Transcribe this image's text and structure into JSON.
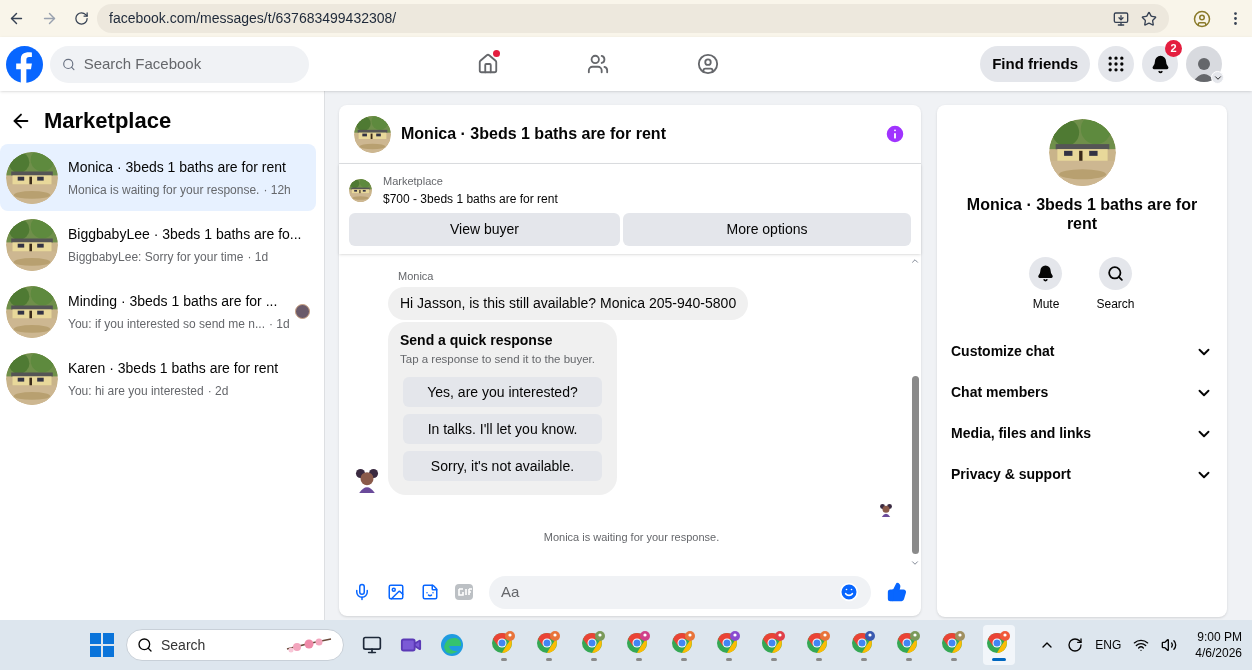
{
  "browser": {
    "url": "facebook.com/messages/t/637683499432308/"
  },
  "header": {
    "search_placeholder": "Search Facebook",
    "nav": [
      {
        "kind": "home",
        "dot": true
      },
      {
        "kind": "friends",
        "dot": false
      },
      {
        "kind": "groups",
        "dot": false
      }
    ],
    "find_friends": "Find friends",
    "notification_count": "2"
  },
  "sidebar": {
    "title": "Marketplace",
    "conversations": [
      {
        "title": "Monica · 3beds 1 baths are for rent",
        "preview": "Monica is waiting for your response.",
        "time": "· 12h",
        "selected": true,
        "seen": false
      },
      {
        "title": "BiggbabyLee · 3beds 1 baths are fo...",
        "preview": "BiggbabyLee: Sorry for your time",
        "time": "· 1d",
        "selected": false,
        "seen": false
      },
      {
        "title": "Minding · 3beds 1 baths are for ...",
        "preview": "You: if you interested so send me n...",
        "time": "· 1d",
        "selected": false,
        "seen": true
      },
      {
        "title": "Karen · 3beds 1 baths are for rent",
        "preview": "You: hi are you interested",
        "time": "· 2d",
        "selected": false,
        "seen": false
      }
    ]
  },
  "chat": {
    "title": "Monica · 3beds 1 baths are for rent",
    "listing": {
      "label": "Marketplace",
      "text": "$700 - 3beds 1 baths are for rent"
    },
    "buttons": [
      "View buyer",
      "More options"
    ],
    "sender": "Monica",
    "message": "Hi Jasson, is this still available? Monica 205-940-5800",
    "quick_response": {
      "title": "Send a quick response",
      "subtitle": "Tap a response to send it to the buyer.",
      "options": [
        "Yes, are you interested?",
        "In talks. I'll let you know.",
        "Sorry, it's not available."
      ]
    },
    "status": "Monica is waiting for your response.",
    "composer_placeholder": "Aa"
  },
  "details": {
    "title": "Monica · 3beds 1 baths are for rent",
    "actions": [
      {
        "kind": "bell",
        "label": "Mute"
      },
      {
        "kind": "search",
        "label": "Search"
      }
    ],
    "sections": [
      {
        "label": "Customize chat",
        "expanded": false
      },
      {
        "label": "Chat members",
        "expanded": false
      },
      {
        "label": "Media, files and links",
        "expanded": false
      },
      {
        "label": "Privacy & support",
        "expanded": false
      }
    ]
  },
  "taskbar": {
    "search_placeholder": "Search",
    "apps": [
      {
        "kind": "chrome",
        "color": "#e8743b",
        "selected": false
      },
      {
        "kind": "chrome",
        "color": "#e8743b",
        "selected": false
      },
      {
        "kind": "chrome",
        "color": "#7a9a5a",
        "selected": false
      },
      {
        "kind": "chrome",
        "color": "#d0408a",
        "selected": false
      },
      {
        "kind": "chrome",
        "color": "#e8743b",
        "selected": false
      },
      {
        "kind": "chrome",
        "color": "#8a4bd0",
        "selected": false
      },
      {
        "kind": "chrome",
        "color": "#e0404a",
        "selected": false
      },
      {
        "kind": "chrome",
        "color": "#e8743b",
        "selected": false
      },
      {
        "kind": "chrome",
        "color": "#3a5ab0",
        "selected": false
      },
      {
        "kind": "chrome",
        "color": "#7a9a5a",
        "selected": false
      },
      {
        "kind": "chrome",
        "color": "#a09060",
        "selected": false
      },
      {
        "kind": "chrome",
        "color": "#f05a3a",
        "selected": true
      }
    ],
    "language": "ENG",
    "time": "9:00 PM",
    "date": "4/6/2026"
  }
}
